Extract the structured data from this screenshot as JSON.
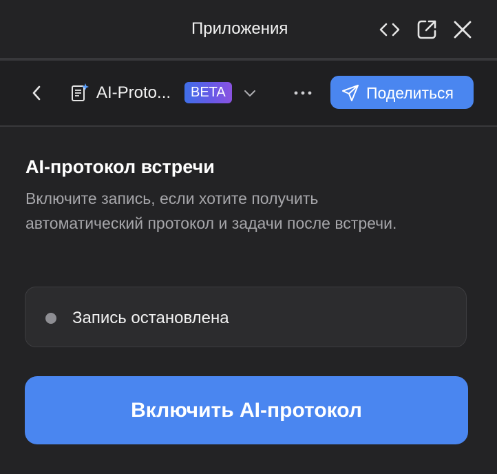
{
  "window": {
    "title": "Приложения",
    "icons": [
      "code-icon",
      "external-link-icon",
      "close-icon"
    ]
  },
  "app_header": {
    "back_icon": "chevron-left-icon",
    "app_icon": "document-sparkle-icon",
    "app_name": "AI-Proto...",
    "badge": "BETA",
    "dropdown_icon": "chevron-down-icon",
    "more_icon": "more-horizontal-icon",
    "share_button": {
      "icon": "send-icon",
      "label": "Поделиться"
    }
  },
  "main": {
    "title": "AI-протокол встречи",
    "description": "Включите запись, если хотите получить автоматический протокол и задачи после встречи.",
    "status": {
      "label": "Запись остановлена",
      "dot_color": "#8e8e93"
    },
    "primary_button": "Включить AI-протокол"
  },
  "colors": {
    "background": "#232325",
    "header_background": "#1f1f21",
    "accent": "#4a86f0",
    "muted_text": "#a6a6aa"
  }
}
